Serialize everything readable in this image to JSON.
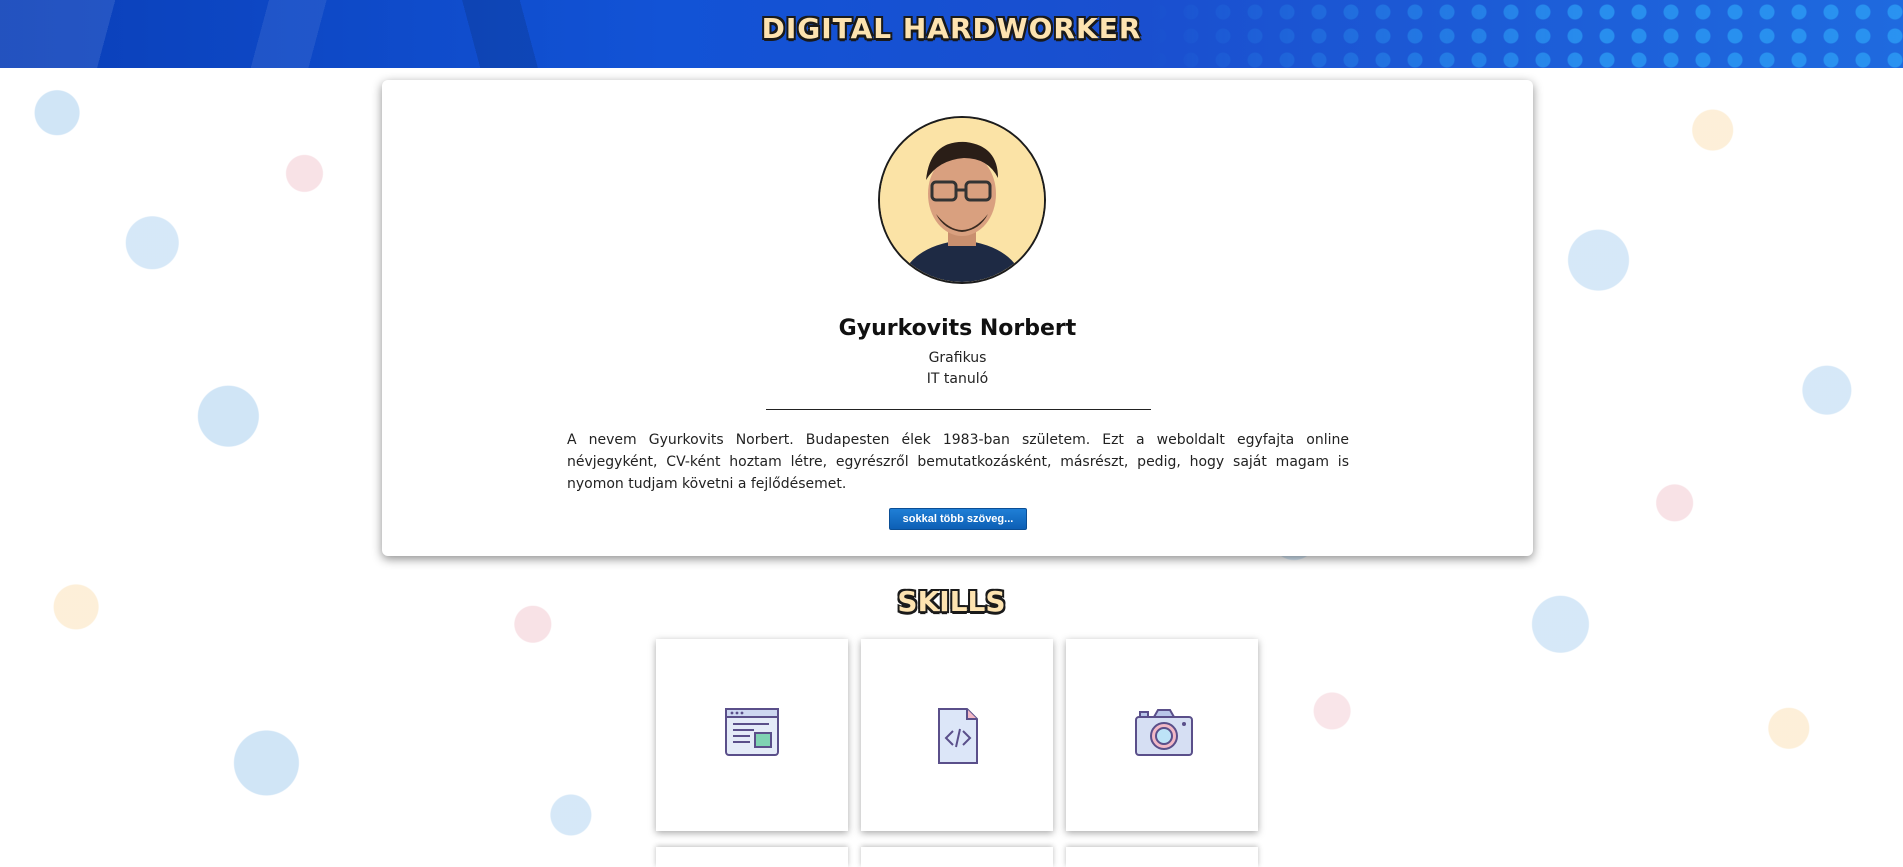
{
  "header": {
    "title": "DIGITAL HARDWORKER"
  },
  "profile": {
    "name": "Gyurkovits Norbert",
    "roles": [
      "Grafikus",
      "IT tanuló"
    ],
    "bio": "A nevem Gyurkovits Norbert. Budapesten élek 1983-ban születem. Ezt a weboldalt egyfajta online névjegyként, CV-ként hoztam létre, egyrészről bemutatkozásként, másrészt, pedig, hogy saját magam is nyomon tudjam követni a fejlődésemet.",
    "more_button": "sokkal több szöveg..."
  },
  "skills": {
    "title": "SKILLS",
    "items": [
      {
        "icon": "web-layout-icon"
      },
      {
        "icon": "code-file-icon"
      },
      {
        "icon": "camera-icon"
      }
    ]
  },
  "colors": {
    "header_blue": "#1253d6",
    "title_cream": "#fde3b0",
    "button_blue": "#0d5fb5",
    "avatar_bg": "#fbe3a6"
  }
}
